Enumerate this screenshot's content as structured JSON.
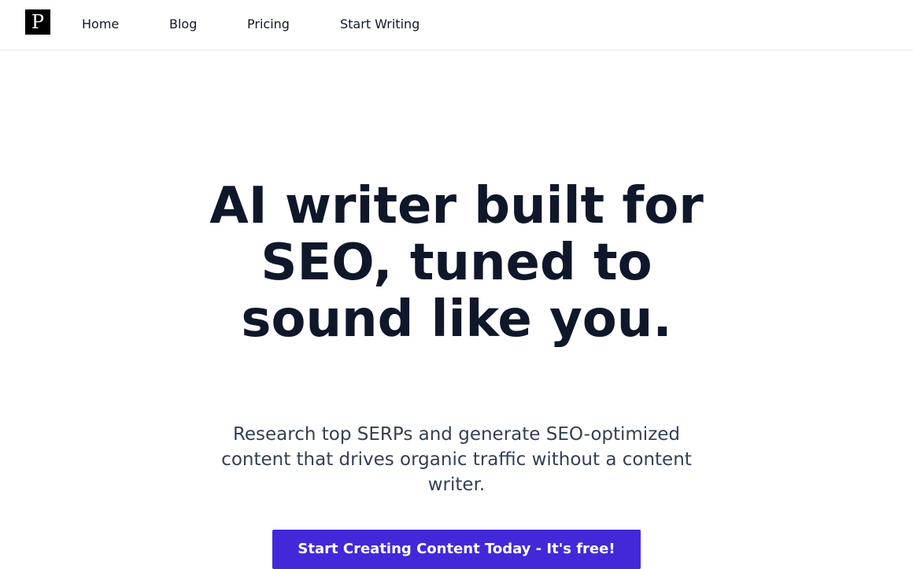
{
  "brand": {
    "logo_letter": "P",
    "logo_bg": "#000000"
  },
  "nav": {
    "items": [
      {
        "label": "Home"
      },
      {
        "label": "Blog"
      },
      {
        "label": "Pricing"
      },
      {
        "label": "Start Writing"
      }
    ]
  },
  "hero": {
    "title": "AI writer built for SEO, tuned to sound like you.",
    "subtitle": "Research top SERPs and generate SEO-optimized content that drives organic traffic without a content writer.",
    "cta_label": "Start Creating Content Today - It's free!"
  },
  "colors": {
    "accent": "#4129d9",
    "heading": "#0f172a",
    "body_text": "#334155",
    "border": "#e5e7eb"
  }
}
